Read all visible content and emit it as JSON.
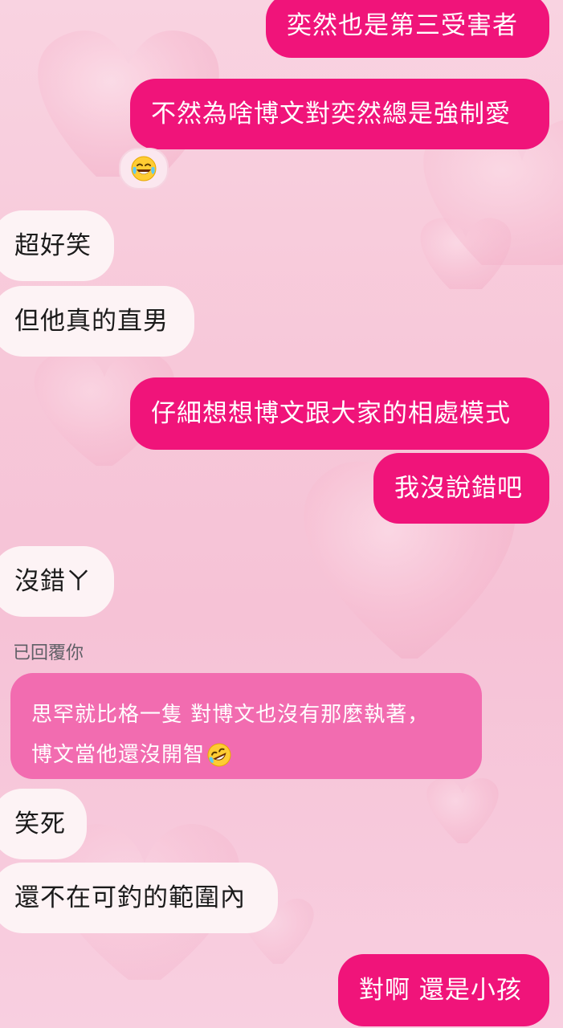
{
  "messages_top": [
    {
      "text": "奕然也是第三受害者"
    },
    {
      "text": "不然為啥博文對奕然總是強制愛"
    }
  ],
  "reaction": {
    "icon": "laughing-tears-emoji"
  },
  "messages_mid": [
    {
      "text": "超好笑"
    },
    {
      "text": "但他真的直男"
    },
    {
      "text": "仔細想想博文跟大家的相處模式"
    },
    {
      "text": "我沒說錯吧"
    },
    {
      "text": "沒錯ㄚ"
    }
  ],
  "reply": {
    "label": "已回覆你",
    "line1": "思罕就比格一隻 對博文也沒有那麼執著，",
    "line2": "博文當他還沒開智",
    "emoji": "rofl-emoji"
  },
  "messages_bottom": [
    {
      "text": "笑死"
    },
    {
      "text": "還不在可釣的範圍內"
    },
    {
      "text": "對啊 還是小孩"
    }
  ],
  "colors": {
    "outgoing": "#f0147a",
    "incoming": "#fdf3f5",
    "reply": "#f26cb0"
  }
}
